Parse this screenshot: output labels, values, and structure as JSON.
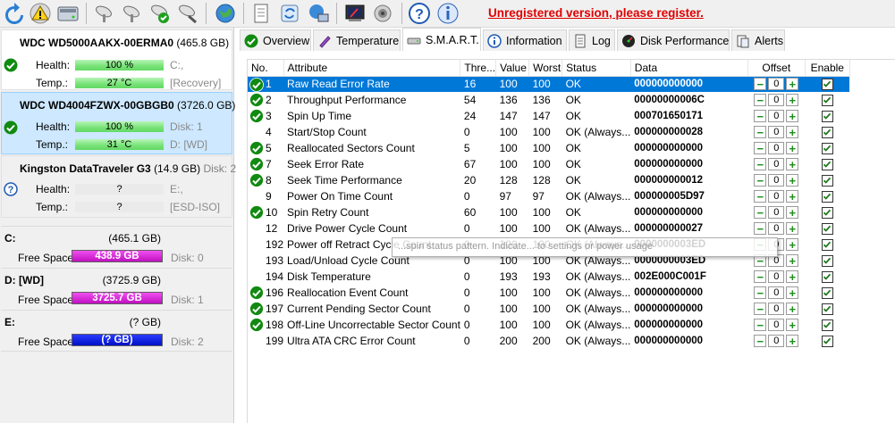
{
  "toolbar": {
    "unregistered_text": "Unregistered version, please register.",
    "buttons": [
      "refresh-icon",
      "warning-icon",
      "disk-icon",
      "satellite-icon",
      "satellite-icon",
      "satellite-check-icon",
      "satellite-tool-icon",
      "globe-icon",
      "document-icon",
      "refresh-arrows-icon",
      "network-icon",
      "terminal-icon",
      "speaker-icon",
      "help-icon",
      "info-icon"
    ]
  },
  "disks": [
    {
      "name": "WDC WD5000AAKX-00ERMA0",
      "size": "(465.8 GB)",
      "disk_label": "",
      "health_label": "Health:",
      "health": "100 %",
      "health_info": "C:,",
      "temp_label": "Temp.:",
      "temp": "27 °C",
      "temp_info": "[Recovery]"
    },
    {
      "name": "WDC WD4004FZWX-00GBGB0",
      "size": "(3726.0 GB)",
      "disk_label": "",
      "health_label": "Health:",
      "health": "100 %",
      "health_info": "Disk: 1",
      "temp_label": "Temp.:",
      "temp": "31 °C",
      "temp_info": "D: [WD]"
    },
    {
      "name": "Kingston DataTraveler G3",
      "size": "(14.9 GB)",
      "disk_label": "Disk: 2",
      "health_label": "Health:",
      "health": "?",
      "health_info": "E:,",
      "temp_label": "Temp.:",
      "temp": "?",
      "temp_info": "[ESD-ISO]"
    }
  ],
  "partitions": [
    {
      "name": "C:",
      "size": "(465.1 GB)",
      "free_label": "Free Space",
      "free": "438.9 GB",
      "disk": "Disk: 0",
      "color": "#e01ce0"
    },
    {
      "name": "D: [WD]",
      "size": "(3725.9 GB)",
      "free_label": "Free Space",
      "free": "3725.7 GB",
      "disk": "Disk: 1",
      "color": "#e01ce0"
    },
    {
      "name": "E:",
      "size": "(? GB)",
      "free_label": "Free Space",
      "free": "(? GB)",
      "disk": "Disk: 2",
      "color": "#0018e0"
    }
  ],
  "tabs": [
    "Overview",
    "Temperature",
    "S.M.A.R.T.",
    "Information",
    "Log",
    "Disk Performance",
    "Alerts"
  ],
  "columns": [
    "No.",
    "Attribute",
    "Thre...",
    "Value",
    "Worst",
    "Status",
    "Data",
    "Offset",
    "Enable"
  ],
  "rows": [
    {
      "no": "1",
      "attr": "Raw Read Error Rate",
      "thr": "16",
      "val": "100",
      "worst": "100",
      "status": "OK",
      "data": "000000000000",
      "offset": "0",
      "ok": true,
      "sel": true
    },
    {
      "no": "2",
      "attr": "Throughput Performance",
      "thr": "54",
      "val": "136",
      "worst": "136",
      "status": "OK",
      "data": "00000000006C",
      "offset": "0",
      "ok": true
    },
    {
      "no": "3",
      "attr": "Spin Up Time",
      "thr": "24",
      "val": "147",
      "worst": "147",
      "status": "OK",
      "data": "000701650171",
      "offset": "0",
      "ok": true
    },
    {
      "no": "4",
      "attr": "Start/Stop Count",
      "thr": "0",
      "val": "100",
      "worst": "100",
      "status": "OK (Always...",
      "data": "000000000028",
      "offset": "0",
      "ok": false
    },
    {
      "no": "5",
      "attr": "Reallocated Sectors Count",
      "thr": "5",
      "val": "100",
      "worst": "100",
      "status": "OK",
      "data": "000000000000",
      "offset": "0",
      "ok": true
    },
    {
      "no": "7",
      "attr": "Seek Error Rate",
      "thr": "67",
      "val": "100",
      "worst": "100",
      "status": "OK",
      "data": "000000000000",
      "offset": "0",
      "ok": true
    },
    {
      "no": "8",
      "attr": "Seek Time Performance",
      "thr": "20",
      "val": "128",
      "worst": "128",
      "status": "OK",
      "data": "000000000012",
      "offset": "0",
      "ok": true
    },
    {
      "no": "9",
      "attr": "Power On Time Count",
      "thr": "0",
      "val": "97",
      "worst": "97",
      "status": "OK (Always...",
      "data": "000000005D97",
      "offset": "0",
      "ok": false
    },
    {
      "no": "10",
      "attr": "Spin Retry Count",
      "thr": "60",
      "val": "100",
      "worst": "100",
      "status": "OK",
      "data": "000000000000",
      "offset": "0",
      "ok": true
    },
    {
      "no": "12",
      "attr": "Drive Power Cycle Count",
      "thr": "0",
      "val": "100",
      "worst": "100",
      "status": "OK (Always...",
      "data": "000000000027",
      "offset": "0",
      "ok": false
    },
    {
      "no": "192",
      "attr": "Power off Retract Cycle Count",
      "thr": "0",
      "val": "100",
      "worst": "100",
      "status": "OK (Always...",
      "data": "0000000003ED",
      "offset": "0",
      "ok": false
    },
    {
      "no": "193",
      "attr": "Load/Unload Cycle Count",
      "thr": "0",
      "val": "100",
      "worst": "100",
      "status": "OK (Always...",
      "data": "0000000003ED",
      "offset": "0",
      "ok": false
    },
    {
      "no": "194",
      "attr": "Disk Temperature",
      "thr": "0",
      "val": "193",
      "worst": "193",
      "status": "OK (Always...",
      "data": "002E000C001F",
      "offset": "0",
      "ok": false
    },
    {
      "no": "196",
      "attr": "Reallocation Event Count",
      "thr": "0",
      "val": "100",
      "worst": "100",
      "status": "OK (Always...",
      "data": "000000000000",
      "offset": "0",
      "ok": true
    },
    {
      "no": "197",
      "attr": "Current Pending Sector Count",
      "thr": "0",
      "val": "100",
      "worst": "100",
      "status": "OK (Always...",
      "data": "000000000000",
      "offset": "0",
      "ok": true
    },
    {
      "no": "198",
      "attr": "Off-Line Uncorrectable Sector Count",
      "thr": "0",
      "val": "100",
      "worst": "100",
      "status": "OK (Always...",
      "data": "000000000000",
      "offset": "0",
      "ok": true
    },
    {
      "no": "199",
      "attr": "Ultra ATA CRC Error Count",
      "thr": "0",
      "val": "200",
      "worst": "200",
      "status": "OK (Always...",
      "data": "000000000000",
      "offset": "0",
      "ok": false
    }
  ],
  "tooltip": "...spin status pattern. Indicate... to settings or power usage"
}
